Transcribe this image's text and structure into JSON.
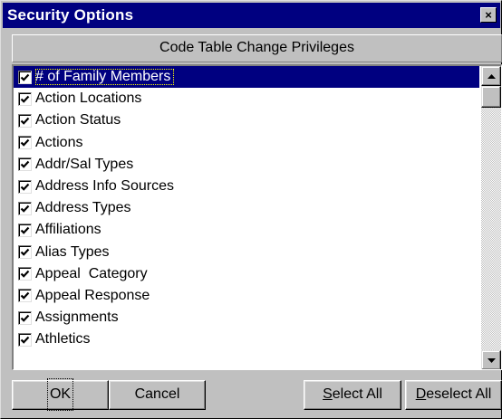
{
  "dialog": {
    "title": "Security Options",
    "close_symbol": "×"
  },
  "list": {
    "header": "Code Table Change Privileges",
    "items": [
      {
        "label": "# of Family Members",
        "checked": true,
        "selected": true
      },
      {
        "label": "Action Locations",
        "checked": true
      },
      {
        "label": "Action Status",
        "checked": true
      },
      {
        "label": "Actions",
        "checked": true
      },
      {
        "label": "Addr/Sal Types",
        "checked": true
      },
      {
        "label": "Address Info Sources",
        "checked": true
      },
      {
        "label": "Address Types",
        "checked": true
      },
      {
        "label": "Affiliations",
        "checked": true
      },
      {
        "label": "Alias Types",
        "checked": true
      },
      {
        "label": "Appeal  Category",
        "checked": true
      },
      {
        "label": "Appeal Response",
        "checked": true
      },
      {
        "label": "Assignments",
        "checked": true
      },
      {
        "label": "Athletics",
        "checked": true
      }
    ]
  },
  "buttons": {
    "ok": "OK",
    "cancel": "Cancel",
    "select_all_first": "S",
    "select_all_rest": "elect All",
    "deselect_all_first": "D",
    "deselect_all_rest": "eselect All"
  },
  "icons": {
    "checkbox": "check-icon",
    "scroll_up": "arrow-up-icon",
    "scroll_down": "arrow-down-icon",
    "close": "close-icon"
  },
  "colors": {
    "title_bar": "#000080",
    "selection": "#000080",
    "face": "#c0c0c0"
  }
}
